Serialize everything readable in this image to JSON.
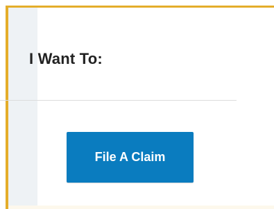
{
  "colors": {
    "accent_border": "#e4ad2a",
    "button_bg": "#0a7cbf",
    "side_strip": "#eef2f5"
  },
  "card": {
    "title": "I Want To:",
    "actions": [
      {
        "label": "File A Claim"
      }
    ]
  }
}
